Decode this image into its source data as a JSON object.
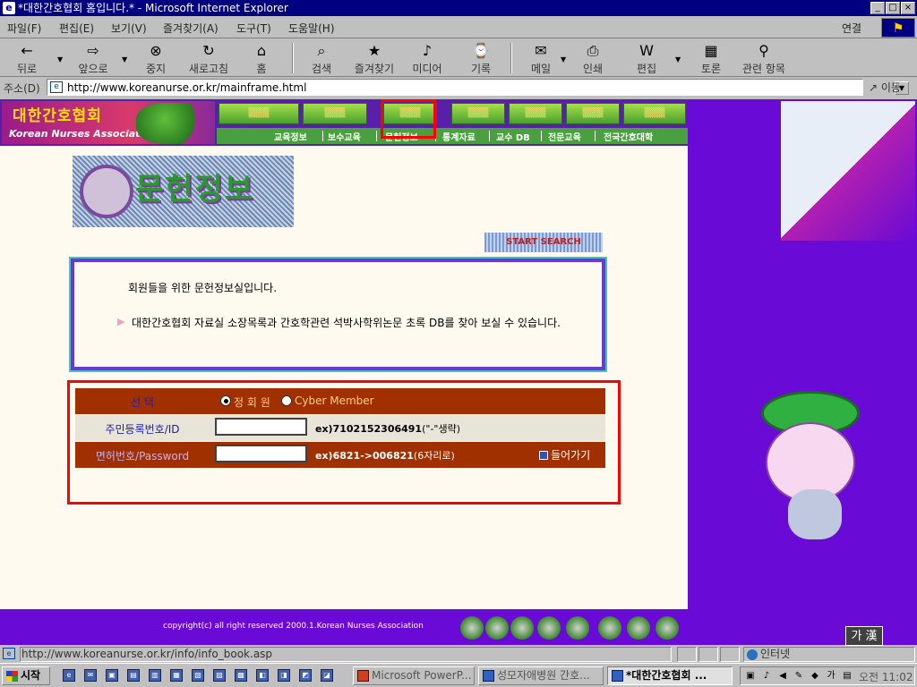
{
  "window": {
    "title": "*대한간호협회 홈입니다.* - Microsoft Internet Explorer"
  },
  "menu": [
    "파일(F)",
    "편집(E)",
    "보기(V)",
    "즐겨찾기(A)",
    "도구(T)",
    "도움말(H)"
  ],
  "menu_right": "연결",
  "toolbar": {
    "back": "뒤로",
    "forward": "앞으로",
    "stop": "중지",
    "refresh": "새로고침",
    "home": "홈",
    "search": "검색",
    "favorites": "즐겨찾기",
    "media": "미디어",
    "history": "기록",
    "mail": "메일",
    "print": "인쇄",
    "edit": "편집",
    "discuss": "토론",
    "related": "관련 항목"
  },
  "address": {
    "label": "주소(D)",
    "url": "http://www.koreanurse.or.kr/mainframe.html",
    "go": "이동"
  },
  "site": {
    "logo_ko": "대한간호협회",
    "logo_en": "Korean Nurses Association",
    "subnav": [
      "교육정보",
      "보수교육",
      "문헌정보",
      "통계자료",
      "교수 DB",
      "전문교육",
      "전국간호대학"
    ],
    "title_image": "문헌정보",
    "start_button": "START SEARCH",
    "info_line1": "회원들을 위한 문헌정보실입니다.",
    "info_line2": "대한간호협회 자료실 소장목록과 간호학관련 석박사학위논문  초록 DB를 찾아 보실 수 있습니다.",
    "login": {
      "select_label": "선          택",
      "option_member": "정 회 원",
      "option_cyber": "Cyber Member",
      "id_label": "주민등록번호/ID",
      "id_hint_bold": "ex)7102152306491",
      "id_hint_rest": "(\"-\"생략)",
      "pw_label": "면허번호/Password",
      "pw_hint_bold": "ex)6821->006821",
      "pw_hint_rest": "(6자리로)",
      "enter": "들어가기"
    },
    "copyright": "copyright(c) all right reserved 2000.1.Korean Nurses Association"
  },
  "ime": "가 漢",
  "status": {
    "text": "http://www.koreanurse.or.kr/info/info_book.asp",
    "zone": "인터넷"
  },
  "taskbar": {
    "start": "시작",
    "tasks": [
      "Microsoft PowerP...",
      "성모자애병원 간호...",
      "*대한간호협회 ..."
    ],
    "clock": "오전 11:02"
  },
  "colors": {
    "accent": "#000080",
    "page_bg": "#fffaf0",
    "outer_bg": "#6a0ad6",
    "login_row": "#a03000",
    "highlight": "#ff0000"
  }
}
